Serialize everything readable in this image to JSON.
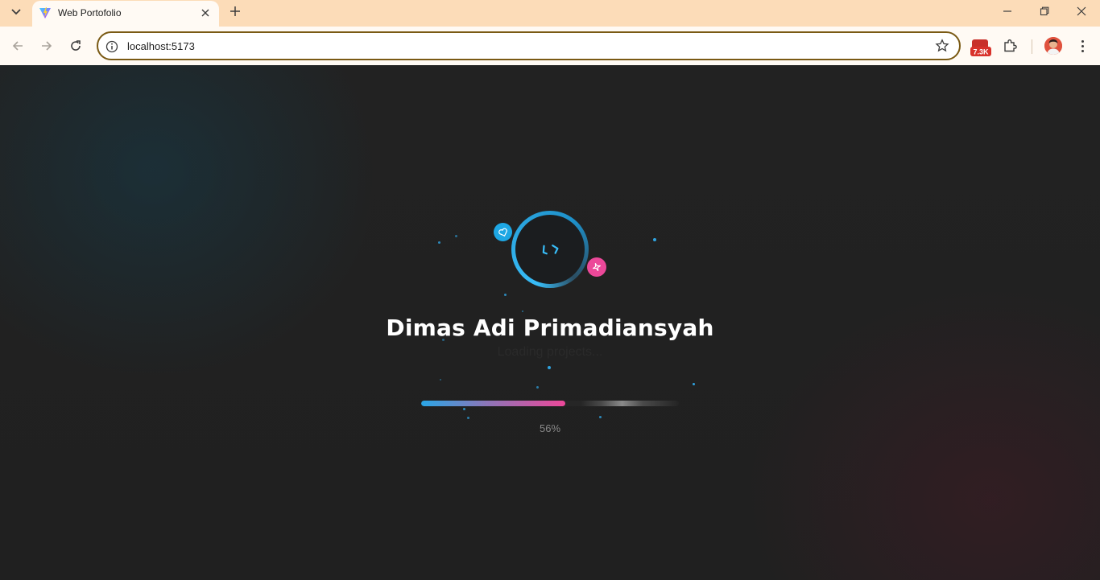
{
  "browser": {
    "tab": {
      "title": "Web Portofolio",
      "favicon": "vite-logo-icon"
    },
    "address_bar": {
      "url": "localhost:5173"
    },
    "extension_badge": "7.3K",
    "accent_color": "#fcdcb8"
  },
  "loader": {
    "name": "Dimas Adi Primadiansyah",
    "status_text": "Loading projects...",
    "progress": {
      "value": 0.56,
      "label": "56%"
    },
    "colors": {
      "primary": "#38bdf8",
      "secondary": "#ec4899"
    },
    "icons": [
      "code-icon",
      "heart-icon",
      "sparkle-icon"
    ]
  }
}
